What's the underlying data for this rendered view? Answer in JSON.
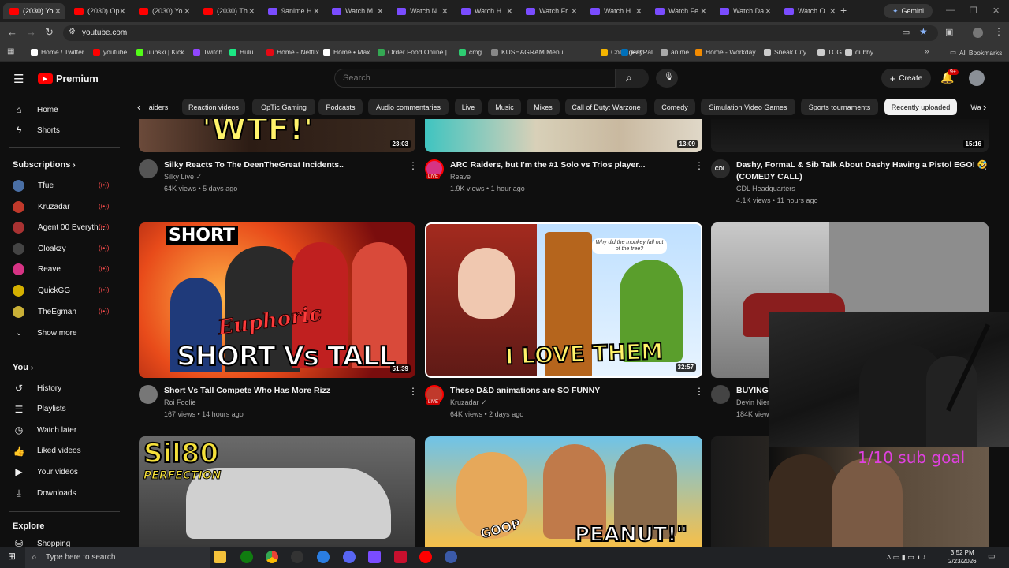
{
  "browser": {
    "tabs": [
      {
        "label": "(2030) Yo",
        "color": "#ff0000",
        "active": true
      },
      {
        "label": "(2030) Op",
        "color": "#ff0000"
      },
      {
        "label": "(2030) Yo",
        "color": "#ff0000"
      },
      {
        "label": "(2030) Th",
        "color": "#ff0000"
      },
      {
        "label": "9anime H",
        "color": "#7a4cff"
      },
      {
        "label": "Watch M",
        "color": "#7a4cff"
      },
      {
        "label": "Watch N",
        "color": "#7a4cff"
      },
      {
        "label": "Watch H",
        "color": "#7a4cff"
      },
      {
        "label": "Watch Fr",
        "color": "#7a4cff"
      },
      {
        "label": "Watch H",
        "color": "#7a4cff"
      },
      {
        "label": "Watch Fe",
        "color": "#7a4cff"
      },
      {
        "label": "Watch Da",
        "color": "#7a4cff"
      },
      {
        "label": "Watch O",
        "color": "#7a4cff"
      }
    ],
    "gemini_label": "Gemini",
    "url": "youtube.com",
    "bookmarks": [
      {
        "label": "Home / Twitter",
        "color": "#ffffff"
      },
      {
        "label": "youtube",
        "color": "#ff0000"
      },
      {
        "label": "uubski | Kick",
        "color": "#53fc18"
      },
      {
        "label": "Twitch",
        "color": "#9146ff"
      },
      {
        "label": "Hulu",
        "color": "#1ce783"
      },
      {
        "label": "Home - Netflix",
        "color": "#e50914"
      },
      {
        "label": "Home • Max",
        "color": "#ffffff"
      },
      {
        "label": "Order Food Online |...",
        "color": "#34a853"
      },
      {
        "label": "cmg",
        "color": "#2ecc71"
      },
      {
        "label": "KUSHAGRAM Menu...",
        "color": "#888888"
      },
      {
        "label": "CoDAgent",
        "color": "#f4b400"
      },
      {
        "label": "PayPal",
        "color": "#0070ba"
      },
      {
        "label": "anime",
        "color": "#aaaaaa"
      },
      {
        "label": "Home - Workday",
        "color": "#f38b00"
      },
      {
        "label": "Sneak City",
        "color": "#cccccc"
      },
      {
        "label": "TCG",
        "color": "#cccccc"
      },
      {
        "label": "dubby",
        "color": "#cccccc"
      }
    ],
    "all_bookmarks": "All Bookmarks"
  },
  "header": {
    "logo_text": "Premium",
    "search_placeholder": "Search",
    "create_label": "Create",
    "notif_count": "9+"
  },
  "sidebar": {
    "home": "Home",
    "shorts": "Shorts",
    "subscriptions_title": "Subscriptions",
    "subscriptions": [
      {
        "name": "Tfue",
        "color": "#4a6fa5",
        "live": true
      },
      {
        "name": "Kruzadar",
        "color": "#c0392b",
        "live": true
      },
      {
        "name": "Agent 00 Everyth...",
        "color": "#a83232",
        "live": true
      },
      {
        "name": "Cloakzy",
        "color": "#444444",
        "live": true
      },
      {
        "name": "Reave",
        "color": "#d63384",
        "live": true
      },
      {
        "name": "QuickGG",
        "color": "#d4b000",
        "live": true
      },
      {
        "name": "TheEgman",
        "color": "#c9b037",
        "live": true
      }
    ],
    "show_more": "Show more",
    "you_title": "You",
    "you_items": [
      {
        "label": "History",
        "icon": "history-icon"
      },
      {
        "label": "Playlists",
        "icon": "playlists-icon"
      },
      {
        "label": "Watch later",
        "icon": "clock-icon"
      },
      {
        "label": "Liked videos",
        "icon": "thumbs-up-icon"
      },
      {
        "label": "Your videos",
        "icon": "your-videos-icon"
      },
      {
        "label": "Downloads",
        "icon": "download-icon"
      }
    ],
    "explore_title": "Explore",
    "shopping": "Shopping"
  },
  "chips": [
    "aiders",
    "Reaction videos",
    "OpTic Gaming",
    "Podcasts",
    "Audio commentaries",
    "Live",
    "Music",
    "Mixes",
    "Call of Duty: Warzone",
    "Comedy",
    "Simulation Video Games",
    "Sports tournaments",
    "Recently uploaded",
    "Wa"
  ],
  "videos_row1": [
    {
      "title": "Silky Reacts To The DeenTheGreat Incidents..",
      "channel": "Silky Live",
      "meta": "64K views • 5 days ago",
      "duration": "23:03",
      "thumb_text": "'WTF!'",
      "avatar": "#555555",
      "verified": true
    },
    {
      "title": "ARC Raiders, but I'm the #1 Solo vs Trios player...",
      "channel": "Reave",
      "meta": "1.9K views • 1 hour ago",
      "duration": "13:09",
      "thumb_text": "",
      "avatar": "#d63384",
      "verified": false
    },
    {
      "title": "Dashy, FormaL & Sib Talk About Dashy Having a Pistol EGO! 🤣",
      "title2": "(COMEDY CALL)",
      "channel": "CDL Headquarters",
      "meta": "4.1K views • 11 hours ago",
      "duration": "15:16",
      "thumb_text": "",
      "avatar": "#2b2b2b",
      "verified": false
    }
  ],
  "videos_row2": [
    {
      "title": "Short Vs Tall Compete Who Has More Rizz",
      "channel": "Roi Foolie",
      "meta": "167 views • 14 hours ago",
      "duration": "51:39",
      "thumb_top": "SHORT",
      "thumb_mid": "Euphoric",
      "thumb_bottom": "SHORT Vs TALL",
      "avatar": "#777777",
      "verified": false
    },
    {
      "title": "These D&D animations are SO FUNNY",
      "channel": "Kruzadar",
      "meta": "64K views • 2 days ago",
      "duration": "32:57",
      "thumb_bubble": "Why did the monkey fall out of the tree?",
      "thumb_bottom": "I LOVE THEM",
      "avatar": "#c0392b",
      "verified": true
    },
    {
      "title": "BUYING",
      "channel": "Devin Nier",
      "meta": "184K views",
      "duration": "",
      "avatar": "#444444",
      "verified": false
    }
  ],
  "videos_row3": [
    {
      "thumb_text": "Sil80",
      "thumb_sub": "PERFECTION"
    },
    {
      "thumb_text": "PEANUT!\"",
      "thumb_sub": "GOOP"
    },
    {
      "thumb_text": ""
    }
  ],
  "stream_overlay": {
    "sub_goal": "1/10 sub goal",
    "emoji": "😅"
  },
  "taskbar": {
    "search_placeholder": "Type here to search",
    "time": "3:52 PM",
    "date": "2/23/2026"
  },
  "colors": {
    "yt_red": "#ff0000",
    "bg": "#0f0f0f",
    "chip": "#272727",
    "live": "#ff4d4d"
  }
}
